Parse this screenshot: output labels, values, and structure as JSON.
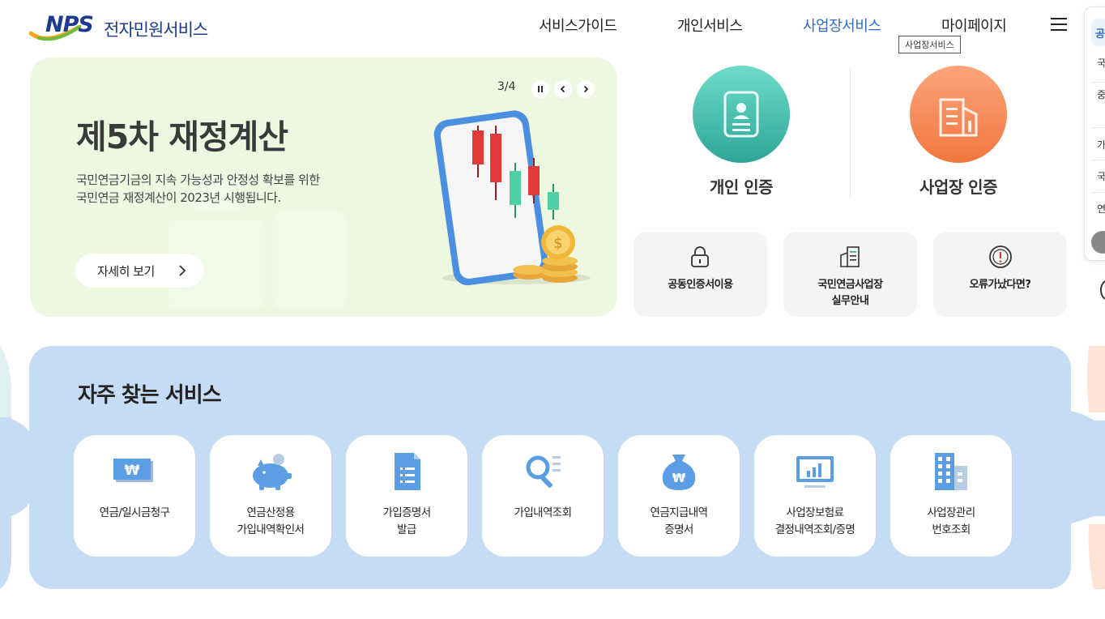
{
  "header": {
    "logo_mark": "NPS",
    "logo_text": "전자민원서비스",
    "nav": [
      {
        "label": "서비스가이드",
        "active": false
      },
      {
        "label": "개인서비스",
        "active": false
      },
      {
        "label": "사업장서비스",
        "active": true
      },
      {
        "label": "마이페이지",
        "active": false
      }
    ],
    "tooltip": "사업장서비스",
    "menu_icon": "hamburger-menu-icon"
  },
  "quick_panel": {
    "items": [
      "공",
      "국민",
      "중",
      "가",
      "국",
      "가",
      "연"
    ]
  },
  "banner": {
    "pager": "3/4",
    "title": "제5차 재정계산",
    "desc_line1": "국민연금기금의 지속 가능성과 안정성 확보를 위한",
    "desc_line2": "국민연금 재정계산이 2023년 시행됩니다.",
    "more_label": "자세히 보기",
    "controls": [
      "pause-icon",
      "prev-icon",
      "next-icon"
    ]
  },
  "certification": {
    "personal": {
      "label": "개인 인증",
      "icon": "id-card-icon",
      "color": "#3fbfae"
    },
    "business": {
      "label": "사업장 인증",
      "icon": "building-icon",
      "color": "#f88a52"
    }
  },
  "quick_links": [
    {
      "label": "공동인증서이용",
      "icon": "lock-icon"
    },
    {
      "label": "국민연금사업장\n실무안내",
      "icon": "document-list-icon"
    },
    {
      "label": "오류가났다면?",
      "icon": "alert-icon"
    }
  ],
  "services": {
    "title": "자주 찾는 서비스",
    "items": [
      {
        "label": "연금/일시금청구",
        "icon": "won-banknote-icon"
      },
      {
        "label": "연금산정용\n가입내역확인서",
        "icon": "piggy-bank-icon"
      },
      {
        "label": "가입증명서\n발급",
        "icon": "document-icon"
      },
      {
        "label": "가입내역조회",
        "icon": "search-list-icon"
      },
      {
        "label": "연금지급내역\n증명서",
        "icon": "money-bag-icon"
      },
      {
        "label": "사업장보험료\n결정내역조회/증명",
        "icon": "monitor-chart-icon"
      },
      {
        "label": "사업장관리\n번호조회",
        "icon": "office-building-icon"
      }
    ]
  },
  "colors": {
    "brand": "#1c3a8f",
    "active_nav": "#2f6bc4",
    "banner_bg": "#eef8e0",
    "services_bg": "#c5dcf4",
    "icon_blue": "#5b9ee4"
  }
}
